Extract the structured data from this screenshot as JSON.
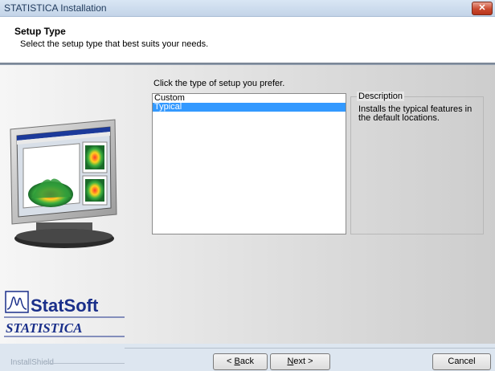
{
  "window": {
    "title": "STATISTICA Installation",
    "close_icon": "close-icon",
    "close_glyph": "✕"
  },
  "header": {
    "title": "Setup Type",
    "subtitle": "Select the setup type that best suits your needs."
  },
  "main": {
    "prompt": "Click the type of setup you prefer.",
    "setup_types": [
      {
        "label": "Custom",
        "selected": false
      },
      {
        "label": "Typical",
        "selected": true
      }
    ],
    "description_label": "Description",
    "description_text": "Installs the typical features in the default locations."
  },
  "branding": {
    "company": "StatSoft",
    "product": "STATISTICA"
  },
  "footer": {
    "installshield": "InstallShield",
    "back_prefix": "< ",
    "back_accel": "B",
    "back_rest": "ack",
    "next_accel": "N",
    "next_rest": "ext >",
    "cancel_label": "Cancel"
  },
  "colors": {
    "selection": "#3399ff",
    "title_text": "#1e395b",
    "close_button": "#c94a30"
  }
}
